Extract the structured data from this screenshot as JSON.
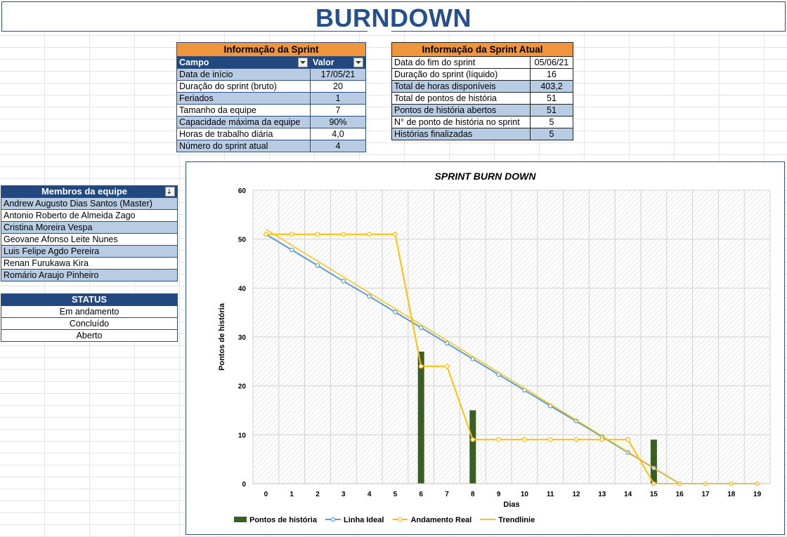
{
  "page": {
    "title": "BURNDOWN"
  },
  "sprint_info": {
    "title": "Informação da Sprint",
    "col_field": "Campo",
    "col_value": "Valor",
    "rows": [
      {
        "label": "Data de início",
        "value": "17/05/21"
      },
      {
        "label": "Duração do sprint (bruto)",
        "value": "20"
      },
      {
        "label": "Feriados",
        "value": "1"
      },
      {
        "label": "Tamanho da equipe",
        "value": "7"
      },
      {
        "label": "Capacidade máxima da equipe",
        "value": "90%"
      },
      {
        "label": "Horas de trabalho diária",
        "value": "4,0"
      },
      {
        "label": "Número do sprint atual",
        "value": "4"
      }
    ]
  },
  "current_sprint": {
    "title": "Informação da Sprint Atual",
    "rows": [
      {
        "label": "Data do fim do sprint",
        "value": "05/06/21"
      },
      {
        "label": "Duração do sprint (líquido)",
        "value": "16"
      },
      {
        "label": "Total de horas disponíveis",
        "value": "403,2"
      },
      {
        "label": "Total de pontos de história",
        "value": "51"
      },
      {
        "label": "Pontos de história abertos",
        "value": "51"
      },
      {
        "label": "N° de ponto de história no sprint",
        "value": "5"
      },
      {
        "label": "Histórias finalizadas",
        "value": "5"
      }
    ]
  },
  "team": {
    "header": "Membros da equipe",
    "members": [
      "Andrew Augusto Dias Santos (Master)",
      "Antonio Roberto de Almeida Zago",
      "Cristina Moreira Vespa",
      "Geovane Afonso Leite Nunes",
      "Luis Felipe Agdo Pereira",
      "Renan Furukawa Kira",
      "Romário Araujo Pinheiro"
    ]
  },
  "status": {
    "header": "STATUS",
    "items": [
      "Em andamento",
      "Concluído",
      "Aberto"
    ]
  },
  "colors": {
    "brand_blue": "#25508d",
    "header_orange": "#f0953c",
    "band_blue": "#b8cce4",
    "bar_green": "#3a5e23",
    "ideal_line": "#5b9bd5",
    "real_line": "#ffc000"
  },
  "chart_data": {
    "type": "line",
    "title": "SPRINT BURN DOWN",
    "xlabel": "Dias",
    "ylabel": "Pontos de história",
    "x": [
      0,
      1,
      2,
      3,
      4,
      5,
      6,
      7,
      8,
      9,
      10,
      11,
      12,
      13,
      14,
      15,
      16,
      17,
      18,
      19
    ],
    "ylim": [
      0,
      60
    ],
    "yticks": [
      0,
      10,
      20,
      30,
      40,
      50,
      60
    ],
    "grid": true,
    "legend_position": "bottom",
    "series": [
      {
        "name": "Pontos de história",
        "kind": "bar",
        "values": [
          null,
          null,
          null,
          null,
          null,
          null,
          27,
          null,
          15,
          null,
          null,
          null,
          null,
          null,
          null,
          9,
          null,
          null,
          null,
          null
        ]
      },
      {
        "name": "Linha Ideal",
        "kind": "line",
        "values": [
          51,
          47.8,
          44.6,
          41.4,
          38.3,
          35.1,
          31.9,
          28.7,
          25.5,
          22.3,
          19.1,
          15.9,
          12.8,
          9.6,
          6.4,
          3.2,
          0,
          null,
          null,
          null
        ]
      },
      {
        "name": "Andamento Real",
        "kind": "line",
        "values": [
          51,
          51,
          51,
          51,
          51,
          51,
          24,
          24,
          9,
          9,
          9,
          9,
          9,
          9,
          9,
          0,
          0,
          0,
          0,
          0
        ]
      },
      {
        "name": "Trendlinie",
        "kind": "trend",
        "values": [
          52,
          0
        ]
      }
    ]
  }
}
